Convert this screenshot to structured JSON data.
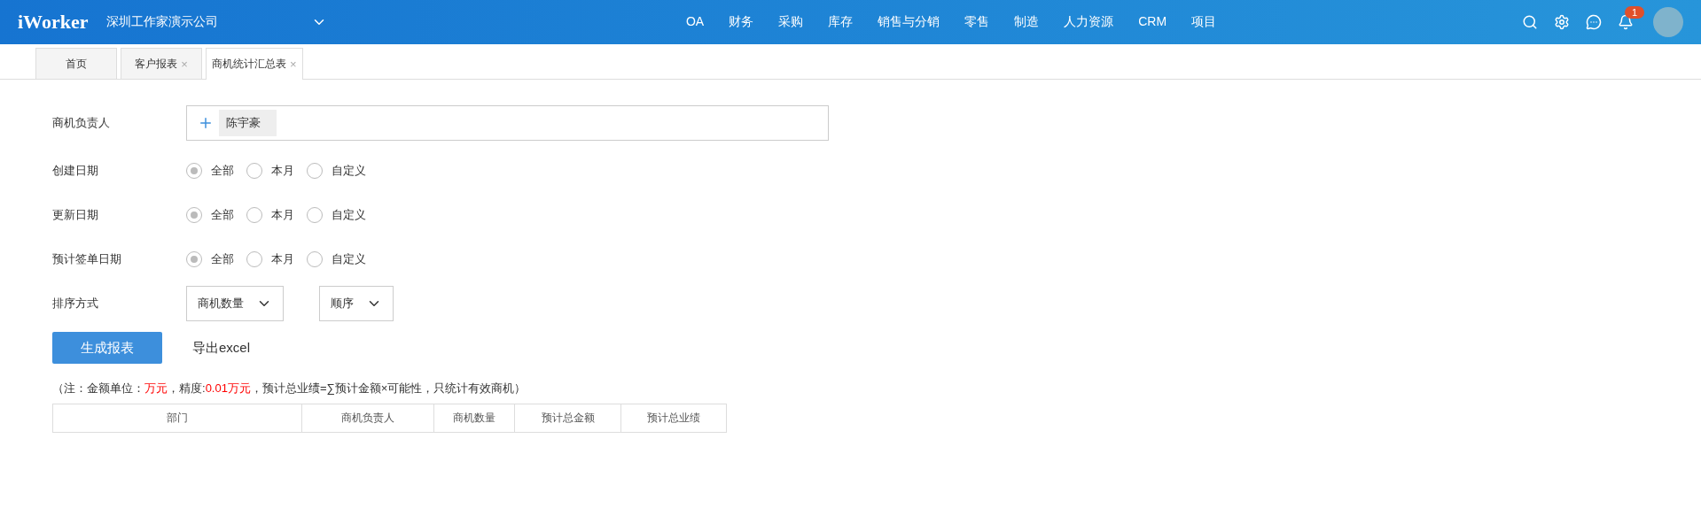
{
  "header": {
    "logo": "iWorker",
    "company": "深圳工作家演示公司",
    "nav": [
      "OA",
      "财务",
      "采购",
      "库存",
      "销售与分销",
      "零售",
      "制造",
      "人力资源",
      "CRM",
      "项目"
    ],
    "notification_count": "1"
  },
  "tabs": [
    {
      "label": "首页",
      "selected": false
    },
    {
      "label": "客户报表",
      "selected": false,
      "close": "×"
    },
    {
      "label": "商机统计汇总表",
      "selected": true,
      "close": "×"
    }
  ],
  "form": {
    "owner": {
      "label": "商机负责人",
      "tags": [
        "陈宇豪"
      ]
    },
    "radio_rows": [
      {
        "label": "创建日期",
        "options": [
          {
            "label": "全部",
            "selected": true
          },
          {
            "label": "本月",
            "selected": false
          },
          {
            "label": "自定义",
            "selected": false
          }
        ]
      },
      {
        "label": "更新日期",
        "options": [
          {
            "label": "全部",
            "selected": true
          },
          {
            "label": "本月",
            "selected": false
          },
          {
            "label": "自定义",
            "selected": false
          }
        ]
      },
      {
        "label": "预计签单日期",
        "options": [
          {
            "label": "全部",
            "selected": true
          },
          {
            "label": "本月",
            "selected": false
          },
          {
            "label": "自定义",
            "selected": false
          }
        ]
      }
    ],
    "sort": {
      "label": "排序方式",
      "field": "商机数量",
      "order": "顺序"
    }
  },
  "actions": {
    "generate": "生成报表",
    "export": "导出excel"
  },
  "note": [
    {
      "text": "（注：金额单位：",
      "highlight": false
    },
    {
      "text": "万元",
      "highlight": true
    },
    {
      "text": "，精度:",
      "highlight": false
    },
    {
      "text": "0.01万元",
      "highlight": true
    },
    {
      "text": "，预计总业绩=∑预计金额×可能性，只统计有效商机）",
      "highlight": false
    }
  ],
  "table": {
    "columns": [
      "部门",
      "商机负责人",
      "商机数量",
      "预计总金额",
      "预计总业绩"
    ]
  }
}
